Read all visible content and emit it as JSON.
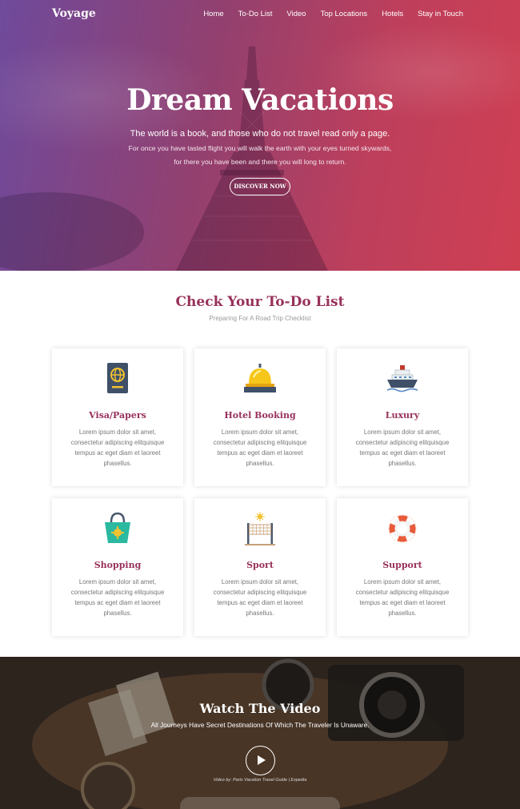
{
  "nav": {
    "brand": "Voyage",
    "links": [
      "Home",
      "To-Do List",
      "Video",
      "Top Locations",
      "Hotels",
      "Stay in Touch"
    ]
  },
  "hero": {
    "title": "Dream Vacations",
    "quote": "The world is a book, and those who do not travel read only a page.",
    "subtitle": "For once you have tasted flight you will walk the earth with your eyes turned skywards, for there you have been and there you will long to return.",
    "button": "DISCOVER NOW"
  },
  "todo": {
    "title": "Check Your To-Do List",
    "subtitle": "Preparing For A Road Trip Checklist",
    "cards": [
      {
        "title": "Visa/Papers",
        "icon": "passport-icon",
        "text": "Lorem ipsum dolor sit amet, consectetur adipiscing elitquisque tempus ac eget diam et laoreet phasellus."
      },
      {
        "title": "Hotel Booking",
        "icon": "service-bell-icon",
        "text": "Lorem ipsum dolor sit amet, consectetur adipiscing elitquisque tempus ac eget diam et laoreet phasellus."
      },
      {
        "title": "Luxury",
        "icon": "cruise-ship-icon",
        "text": "Lorem ipsum dolor sit amet, consectetur adipiscing elitquisque tempus ac eget diam et laoreet phasellus."
      },
      {
        "title": "Shopping",
        "icon": "shopping-bag-icon",
        "text": "Lorem ipsum dolor sit amet, consectetur adipiscing elitquisque tempus ac eget diam et laoreet phasellus."
      },
      {
        "title": "Sport",
        "icon": "volleyball-net-icon",
        "text": "Lorem ipsum dolor sit amet, consectetur adipiscing elitquisque tempus ac eget diam et laoreet phasellus."
      },
      {
        "title": "Support",
        "icon": "lifebuoy-icon",
        "text": "Lorem ipsum dolor sit amet, consectetur adipiscing elitquisque tempus ac eget diam et laoreet phasellus."
      }
    ]
  },
  "video": {
    "title": "Watch The Video",
    "subtitle": "All Journeys Have Secret Destinations Of Which The Traveler Is Unaware.",
    "credit": "Video by: Paris Vacation Travel Guide | Expedia"
  },
  "colors": {
    "accent": "#98315b",
    "hero_gradient_start": "#6f4a9c",
    "hero_gradient_end": "#cf3f52"
  }
}
